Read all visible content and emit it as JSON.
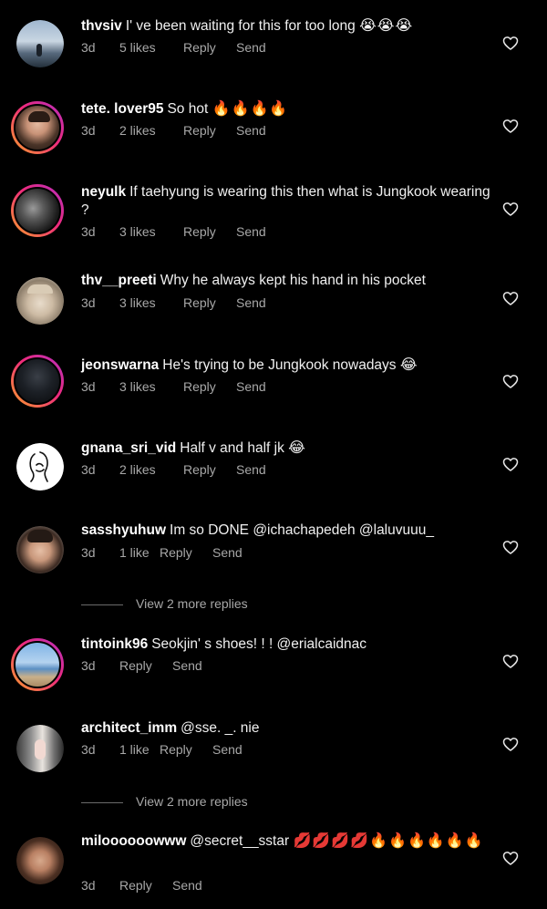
{
  "comments": [
    {
      "username": "thvsiv",
      "text": "I' ve been waiting for this for too long",
      "emoji": "😭😭😭",
      "time": "3d",
      "likes": "5 likes",
      "reply": "Reply",
      "send": "Send"
    },
    {
      "username": "tete. lover95",
      "text": "So hot",
      "emoji": "🔥🔥🔥🔥",
      "time": "3d",
      "likes": "2 likes",
      "reply": "Reply",
      "send": "Send"
    },
    {
      "username": "neyulk",
      "text": "If taehyung is wearing this then what is Jungkook wearing ?",
      "emoji": "",
      "time": "3d",
      "likes": "3 likes",
      "reply": "Reply",
      "send": "Send"
    },
    {
      "username": "thv__preeti",
      "text": "Why  he always kept his hand in his pocket",
      "emoji": "",
      "time": "3d",
      "likes": "3 likes",
      "reply": "Reply",
      "send": "Send"
    },
    {
      "username": "jeonswarna",
      "text": "He's trying to be Jungkook nowadays",
      "emoji": "😂",
      "time": "3d",
      "likes": "3 likes",
      "reply": "Reply",
      "send": "Send"
    },
    {
      "username": "gnana_sri_vid",
      "text": "Half v and half jk",
      "emoji": "😂",
      "time": "3d",
      "likes": "2 likes",
      "reply": "Reply",
      "send": "Send"
    },
    {
      "username": "sasshyuhuw",
      "text": "Im so DONE @ichachapedeh @laluvuuu_",
      "emoji": "",
      "time": "3d",
      "likes": "1 like",
      "reply": "Reply",
      "send": "Send",
      "view_replies": "View 2 more replies"
    },
    {
      "username": "tintoink96",
      "text": "Seokjin' s shoes! ! !  @erialcaidnac",
      "emoji": "",
      "time": "3d",
      "likes": "",
      "reply": "Reply",
      "send": "Send"
    },
    {
      "username": "architect_imm",
      "text": "@sse. _. nie",
      "emoji": "",
      "time": "3d",
      "likes": "1 like",
      "reply": "Reply",
      "send": "Send",
      "view_replies": "View 2 more replies"
    },
    {
      "username": "miloooooowww",
      "text": "@secret__sstar",
      "emoji": "💋💋💋💋🔥🔥🔥🔥🔥🔥",
      "time": "3d",
      "likes": "",
      "reply": "Reply",
      "send": "Send"
    }
  ],
  "colors": {
    "background": "#000000",
    "primary_text": "#ffffff",
    "secondary_text": "#a8a8a8",
    "story_ring_start": "#f9a02a",
    "story_ring_end": "#b42fc0"
  },
  "icons": {
    "like": "heart-outline-icon"
  }
}
